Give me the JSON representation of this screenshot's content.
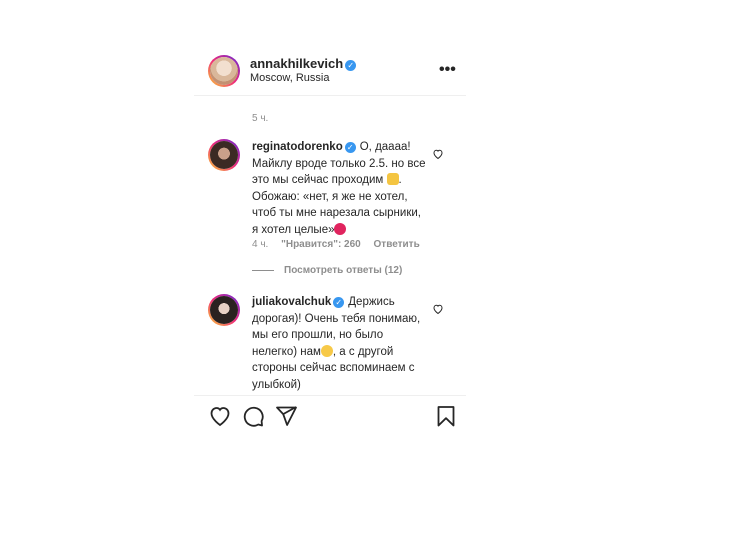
{
  "post": {
    "author": {
      "username": "annakhilkevich",
      "location": "Moscow, Russia",
      "verified": true
    },
    "more_label": "•••",
    "time": "5 ч."
  },
  "comments": [
    {
      "username": "reginatodorenko",
      "verified": true,
      "text_parts": [
        "О, даааа! Майклу вроде только 2.5. но все это мы сейчас проходим ",
        ". Обожаю: «нет, я же не хотел, чтоб ты мне нарезала сырники, я хотел целые»"
      ],
      "time": "4 ч.",
      "likes": "\"Нравится\": 260",
      "reply_label": "Ответить",
      "view_replies": "Посмотреть ответы (12)"
    },
    {
      "username": "juliakovalchuk",
      "verified": true,
      "text_parts": [
        "Держись дорогая)! Очень тебя понимаю, мы его прошли, но было нелегко) нам",
        ", а с другой стороны сейчас вспоминаем с улыбкой)"
      ]
    }
  ],
  "icons": [
    "heart-icon",
    "comment-icon",
    "share-icon",
    "bookmark-icon"
  ],
  "colors": {
    "text": "#262626",
    "secondary": "#8e8e8e",
    "verified": "#3897f0",
    "divider": "#efefef"
  }
}
